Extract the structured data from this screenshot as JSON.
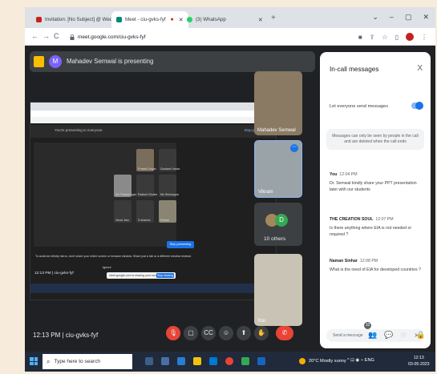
{
  "browser": {
    "tabs": [
      {
        "label": "Invitation: [No Subject] @ Wed 1",
        "favicon_color": "#c5221f"
      },
      {
        "label": "Meet - ciu-gvks-fyf",
        "favicon_color": "#00897b"
      },
      {
        "label": "(3) WhatsApp",
        "favicon_color": "#25d366"
      }
    ],
    "url": "meet.google.com/ciu-gvks-fyf",
    "new_tab": "+",
    "window_controls": [
      "⌄",
      "–",
      "▢",
      "✕"
    ]
  },
  "meet": {
    "presenting_banner": "Mahadev Semwal is presenting",
    "presenter_initial": "M",
    "meeting_time": "12:13 PM",
    "meeting_code": "ciu-gvks-fyf",
    "participants": [
      {
        "name": "Mahadev Semwal"
      },
      {
        "name": "Vikram"
      },
      {
        "name": "10 others"
      },
      {
        "name": "You"
      }
    ],
    "others_avatar_initial": "D"
  },
  "shared_screen": {
    "meet_bar_label": "You're presenting to everyone",
    "meet_bar_action": "Stop presenting",
    "tiles": [
      "Prasad Uniyal",
      "Gautami Yadav",
      "Sin Prasad Agarw",
      "Rashmi Shukla",
      "Ms Shivangna",
      "Vinod Jain",
      "S sharma",
      "Kishan"
    ],
    "tip_button": "Stop presenting",
    "note1": "To avoid an infinity mirror, don't share your entire screen or browser window. Share just a tab or a different window instead.",
    "note2": "Ignore",
    "time": "12:13 PM",
    "code": "ciu-gvks-fyf",
    "pill_text": "meet.google.com is sharing your screen.",
    "pill_button": "Stop sharing"
  },
  "chat": {
    "title": "In-call messages",
    "close": "X",
    "toggle_label": "Let everyone send messages",
    "notice": "Messages can only be seen by people in the call and are deleted when the call ends",
    "messages": [
      {
        "sender": "You",
        "time": "12:04 PM",
        "text": "Dr. Semwal kindly share your PPT presentation later with our students"
      },
      {
        "sender": "THE CREATION SOUL",
        "time": "12:07 PM",
        "text": "Is there anything where EIA is not needed or required ?"
      },
      {
        "sender": "Naman Sinhar",
        "time": "12:08 PM",
        "text": "What is the need of EIA for developed countries ?"
      }
    ],
    "input_placeholder": "Send a message",
    "send_icon": "➤"
  },
  "controls": {
    "mic": "🎙",
    "camera": "▢",
    "captions": "CC",
    "emoji": "☺",
    "present": "⬆",
    "raise_hand": "✋",
    "more": "⋮",
    "end": "✆",
    "info": "ⓘ",
    "people": "👥",
    "chat": "💬",
    "activities": "⬟",
    "lock": "🔒",
    "badge_count": "10"
  },
  "taskbar": {
    "search_placeholder": "Type here to search",
    "weather": "20°C Mostly sunny",
    "tray": "ENG",
    "time": "12:13",
    "date": "03-05-2023"
  }
}
